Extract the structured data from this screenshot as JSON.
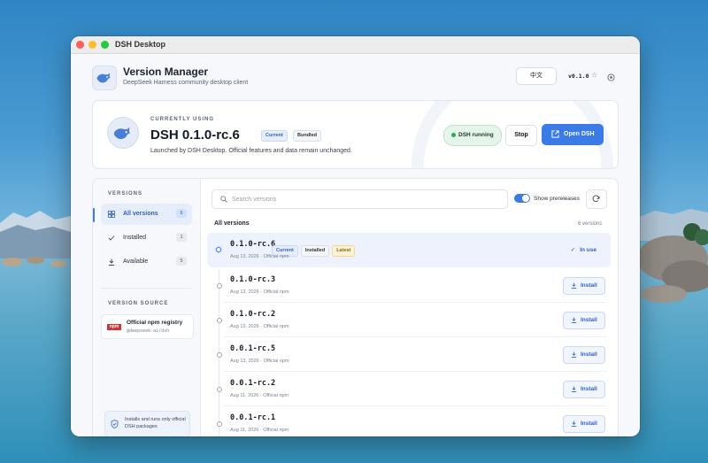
{
  "window": {
    "title": "DSH Desktop"
  },
  "header": {
    "title": "Version Manager",
    "subtitle": "DeepSeek Harness community desktop client",
    "language_button": "中文",
    "app_version": "v0.1.0"
  },
  "current": {
    "label": "CURRENTLY USING",
    "version": "DSH 0.1.0-rc.6",
    "badges": [
      "Current",
      "Bundled"
    ],
    "description": "Launched by DSH Desktop. Official features and data remain unchanged.",
    "status": "DSH running",
    "stop_label": "Stop",
    "open_label": "Open DSH"
  },
  "sidebar": {
    "versions_heading": "VERSIONS",
    "items": [
      {
        "label": "All versions",
        "count": "6",
        "active": true
      },
      {
        "label": "Installed",
        "count": "1",
        "active": false
      },
      {
        "label": "Available",
        "count": "5",
        "active": false
      }
    ],
    "source_heading": "VERSION SOURCE",
    "source": {
      "name": "Official npm registry",
      "package": "@deepseek-ai/dsh",
      "logo_text": "npm"
    },
    "notice": "Installs and runs only official DSH packages"
  },
  "list": {
    "search_placeholder": "Search versions",
    "search_value": "",
    "show_prereleases_label": "Show prereleases",
    "show_prereleases": true,
    "title": "All versions",
    "count_label": "6 versions",
    "install_label": "Install",
    "in_use_label": "In use",
    "rows": [
      {
        "version": "0.1.0-rc.6",
        "meta": "Aug 13, 2026 · Official npm",
        "badges": [
          "Current",
          "Installed",
          "Latest"
        ],
        "in_use": true
      },
      {
        "version": "0.1.0-rc.3",
        "meta": "Aug 13, 2026 · Official npm",
        "badges": [],
        "in_use": false
      },
      {
        "version": "0.1.0-rc.2",
        "meta": "Aug 13, 2026 · Official npm",
        "badges": [],
        "in_use": false
      },
      {
        "version": "0.0.1-rc.5",
        "meta": "Aug 13, 2026 · Official npm",
        "badges": [],
        "in_use": false
      },
      {
        "version": "0.0.1-rc.2",
        "meta": "Aug 11, 2026 · Official npm",
        "badges": [],
        "in_use": false
      },
      {
        "version": "0.0.1-rc.1",
        "meta": "Aug 11, 2026 · Official npm",
        "badges": [],
        "in_use": false
      }
    ]
  },
  "colors": {
    "accent": "#3a7be8",
    "running": "#2fa85a",
    "npm": "#cb3837"
  }
}
